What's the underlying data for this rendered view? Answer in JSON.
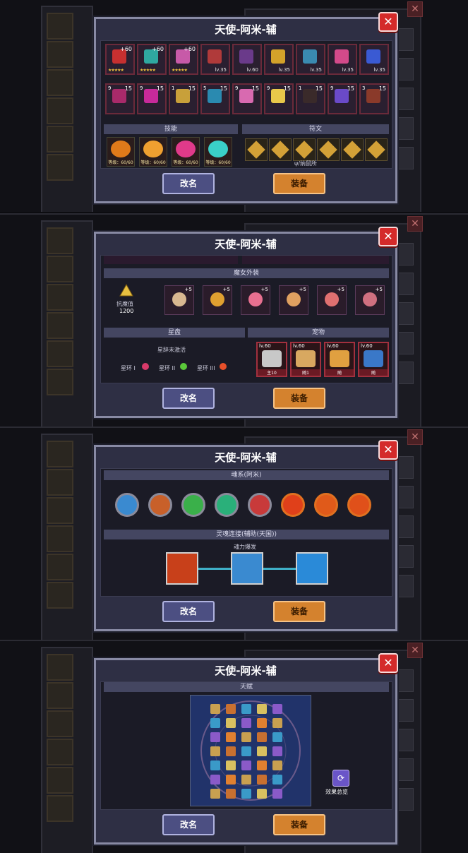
{
  "dialog": {
    "title": "天使-阿米-辅",
    "close_icon": "✕",
    "rename_label": "改名",
    "equip_label": "装备"
  },
  "panel1": {
    "equipment_row1": [
      {
        "label": "+60",
        "color": "#c73030",
        "stars": "★★★★★"
      },
      {
        "label": "+60",
        "color": "#2fa8a0",
        "stars": "★★★★★"
      },
      {
        "label": "+60",
        "color": "#c75aa8",
        "stars": "★★★★★"
      },
      {
        "label": "lv.35",
        "color": "#b03a3a",
        "stars": ""
      },
      {
        "label": "lv.60",
        "color": "#6a3a8a",
        "stars": ""
      },
      {
        "label": "lv.35",
        "color": "#d3a22a",
        "stars": ""
      },
      {
        "label": "lv.35",
        "color": "#3a8ab0",
        "stars": ""
      },
      {
        "label": "lv.35",
        "color": "#d34a8a",
        "stars": ""
      },
      {
        "label": "lv.35",
        "color": "#3a5ad3",
        "stars": ""
      }
    ],
    "equipment_row2": [
      {
        "badge": "9",
        "label": "15",
        "color": "#a82a6a"
      },
      {
        "badge": "9",
        "label": "15",
        "color": "#c72a9a"
      },
      {
        "badge": "1",
        "label": "15",
        "color": "#c8a03a"
      },
      {
        "badge": "5",
        "label": "15",
        "color": "#2a8ab0"
      },
      {
        "badge": "9",
        "label": "15",
        "color": "#d86ab0"
      },
      {
        "badge": "9",
        "label": "15",
        "color": "#e8c84a"
      },
      {
        "badge": "1",
        "label": "15",
        "color": "#3a2a2a"
      },
      {
        "badge": "9",
        "label": "15",
        "color": "#6a4ac8"
      },
      {
        "badge": "3",
        "label": "15",
        "color": "#8a3a2a"
      }
    ],
    "skills_header": "技能",
    "runes_header": "符文",
    "skills": [
      {
        "level": "等级：60/60",
        "color": "#e07a1a"
      },
      {
        "level": "等级：60/60",
        "color": "#f0a030"
      },
      {
        "level": "等级：60/60",
        "color": "#e03a8a"
      },
      {
        "level": "等级：60/60",
        "color": "#3ad0c8"
      }
    ],
    "rune_count": 6,
    "rune_note": "ψ/纳鼠所"
  },
  "panel2": {
    "witch_outfit_header": "魔女外装",
    "resist_label": "抗魔值",
    "resist_value": "1200",
    "outfits": [
      {
        "label": "+5",
        "color": "#d8b890"
      },
      {
        "label": "+5",
        "color": "#e0a030"
      },
      {
        "label": "+5",
        "color": "#e87090"
      },
      {
        "label": "+5",
        "color": "#e0a060"
      },
      {
        "label": "+5",
        "color": "#e07070"
      },
      {
        "label": "+5",
        "color": "#d07080"
      }
    ],
    "star_disc_header": "星盘",
    "star_disc_status": "星辞未激活",
    "rings": [
      "星环 I",
      "星环 II",
      "星环 III"
    ],
    "pet_header": "宠物",
    "pets": [
      {
        "level": "lv.60",
        "name": "主10",
        "color": "#c8c8c8"
      },
      {
        "level": "lv.60",
        "name": "随1",
        "color": "#d8a860"
      },
      {
        "level": "lv.60",
        "name": "随",
        "color": "#e0a040"
      },
      {
        "level": "lv.60",
        "name": "随",
        "color": "#3a78c8"
      }
    ]
  },
  "panel3": {
    "soul_header": "魂系(阿米)",
    "orbs": [
      "#3a8ad0",
      "#c8602a",
      "#3ab04a",
      "#2ab07a",
      "#c83a3a",
      "#e0401a",
      "#e05a1a",
      "#e0501a"
    ],
    "link_header": "灵魂连接(辅助(天国))",
    "link_sub": "魂力爆发",
    "nodes": [
      "#c8401a",
      "#3a8ad0",
      "#2a8ad8"
    ]
  },
  "panel4": {
    "talent_header": "天赋",
    "overview_label": "效果总览",
    "overview_icon": "⟳"
  }
}
